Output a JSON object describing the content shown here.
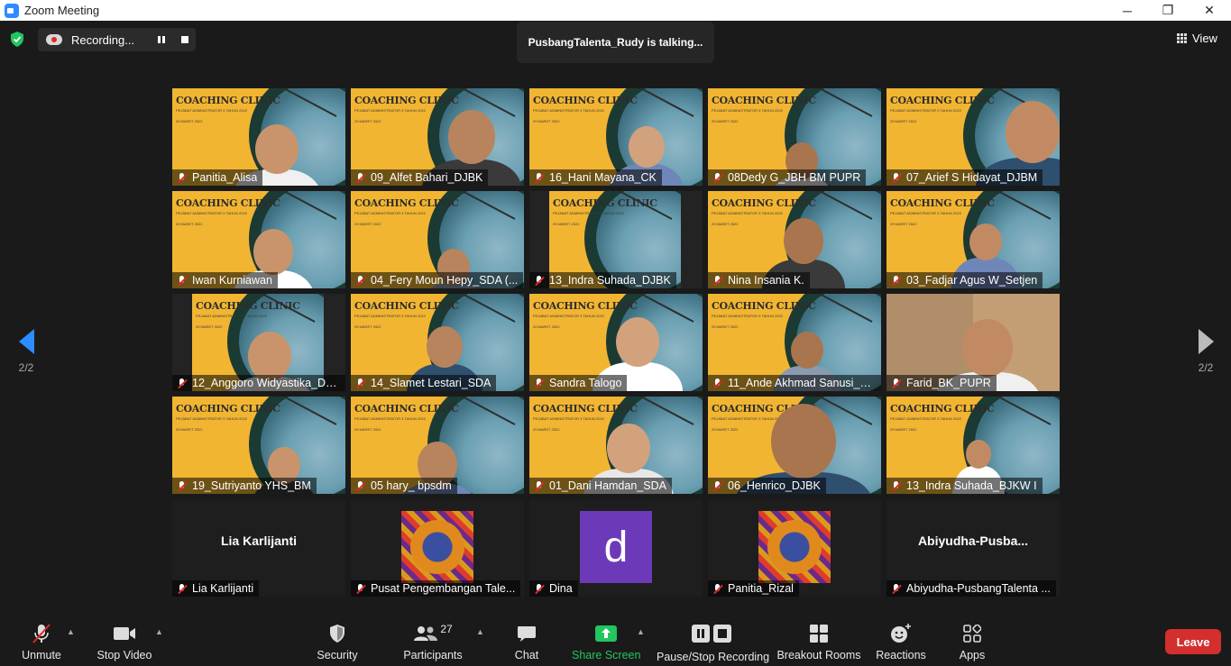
{
  "window": {
    "title": "Zoom Meeting",
    "minimize": "─",
    "maximize": "❐",
    "close": "✕"
  },
  "top": {
    "recording_label": "Recording...",
    "talking": "PusbangTalenta_Rudy is talking...",
    "view_label": "View"
  },
  "pager": {
    "left": "2/2",
    "right": "2/2"
  },
  "tile_banner": {
    "title": "COACHING CLINIC",
    "subtitle": "PEJABAT ADMINISTRATOR 3 TAHUN 2022",
    "date": "29 MARET 2022"
  },
  "participants": [
    {
      "name": "Panitia_Alisa"
    },
    {
      "name": "09_Alfet Bahari_DJBK"
    },
    {
      "name": "16_Hani Mayana_CK"
    },
    {
      "name": "08Dedy G_JBH BM PUPR"
    },
    {
      "name": "07_Arief S Hidayat_DJBM"
    },
    {
      "name": "Iwan Kurniawan"
    },
    {
      "name": "04_Fery Moun Hepy_SDA (..."
    },
    {
      "name": "13_Indra Suhada_DJBK"
    },
    {
      "name": "Nina Insania K."
    },
    {
      "name": "03_Fadjar Agus W_Setjen"
    },
    {
      "name": "12_Anggoro Widyastika_DJPI"
    },
    {
      "name": "14_Slamet Lestari_SDA"
    },
    {
      "name": "Sandra Talogo"
    },
    {
      "name": "11_Ande Akhmad Sanusi_D..."
    },
    {
      "name": "Farid_BK_PUPR"
    },
    {
      "name": "19_Sutriyanto YHS_BM"
    },
    {
      "name": "05 hary_ bpsdm"
    },
    {
      "name": "01_Dani Hamdan_SDA"
    },
    {
      "name": "06_Henrico_DJBK"
    },
    {
      "name": "13_Indra Suhada_BJKW I"
    },
    {
      "name": "Lia Karlijanti",
      "big": "Lia Karlijanti"
    },
    {
      "name": "Pusat Pengembangan Tale..."
    },
    {
      "name": "Dina",
      "avatar_letter": "d"
    },
    {
      "name": "Panitia_Rizal"
    },
    {
      "name": "Abiyudha-PusbangTalenta ...",
      "big": "Abiyudha-Pusba..."
    }
  ],
  "toolbar": {
    "unmute": "Unmute",
    "stop_video": "Stop Video",
    "security": "Security",
    "participants": "Participants",
    "participants_count": "27",
    "chat": "Chat",
    "share_screen": "Share Screen",
    "pause_stop_recording": "Pause/Stop Recording",
    "breakout_rooms": "Breakout Rooms",
    "reactions": "Reactions",
    "apps": "Apps",
    "leave": "Leave"
  },
  "colors": {
    "accent": "#2d8cff",
    "share_green": "#22c55e",
    "leave_red": "#d32f2f",
    "tile_bg": "#f2b531"
  }
}
